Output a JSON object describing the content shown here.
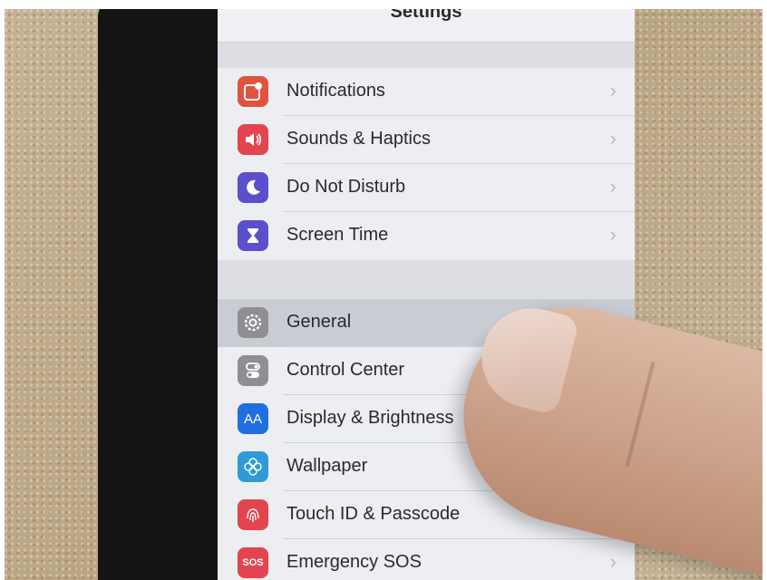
{
  "navbar": {
    "title": "Settings"
  },
  "groups": [
    {
      "items": [
        {
          "label": "Notifications",
          "icon": "notifications-icon",
          "color": "#e0533f"
        },
        {
          "label": "Sounds & Haptics",
          "icon": "speaker-icon",
          "color": "#e2454f"
        },
        {
          "label": "Do Not Disturb",
          "icon": "moon-icon",
          "color": "#5a4fcf"
        },
        {
          "label": "Screen Time",
          "icon": "hourglass-icon",
          "color": "#5a4fcf"
        }
      ]
    },
    {
      "items": [
        {
          "label": "General",
          "icon": "gear-icon",
          "color": "#8e8e93",
          "highlighted": true
        },
        {
          "label": "Control Center",
          "icon": "toggles-icon",
          "color": "#8e8e93"
        },
        {
          "label": "Display & Brightness",
          "icon": "text-size-icon",
          "color": "#1f6fe0",
          "icon_text": "AA"
        },
        {
          "label": "Wallpaper",
          "icon": "flower-icon",
          "color": "#2f9bd6"
        },
        {
          "label": "Touch ID & Passcode",
          "icon": "fingerprint-icon",
          "color": "#e2454f"
        },
        {
          "label": "Emergency SOS",
          "icon": "sos-icon",
          "color": "#e2454f",
          "icon_text": "SOS"
        }
      ]
    }
  ],
  "chevron": "›"
}
